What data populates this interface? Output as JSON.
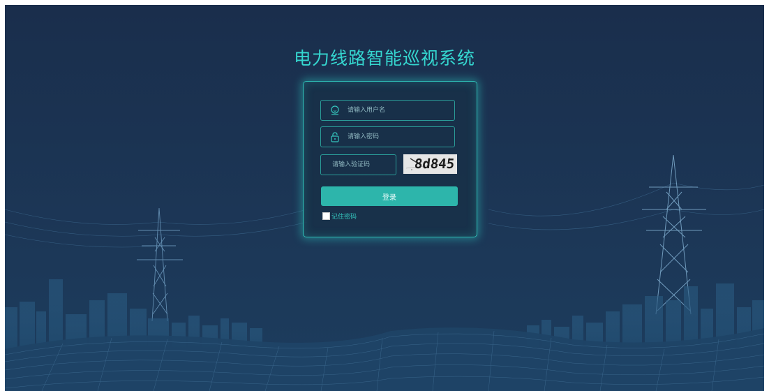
{
  "app": {
    "title": "电力线路智能巡视系统"
  },
  "login_form": {
    "username_placeholder": "请输入用户名",
    "password_placeholder": "请输入密码",
    "captcha_placeholder": "请输入验证码",
    "captcha_text": "8d845",
    "login_label": "登录",
    "remember_label": "记住密码",
    "remember_checked": false
  },
  "icons": {
    "username": "user-icon",
    "password": "lock-icon"
  },
  "colors": {
    "background": "#1a2e4c",
    "accent": "#35d7d0",
    "button": "#2db5ab",
    "panel_border": "#2fbfb7"
  }
}
